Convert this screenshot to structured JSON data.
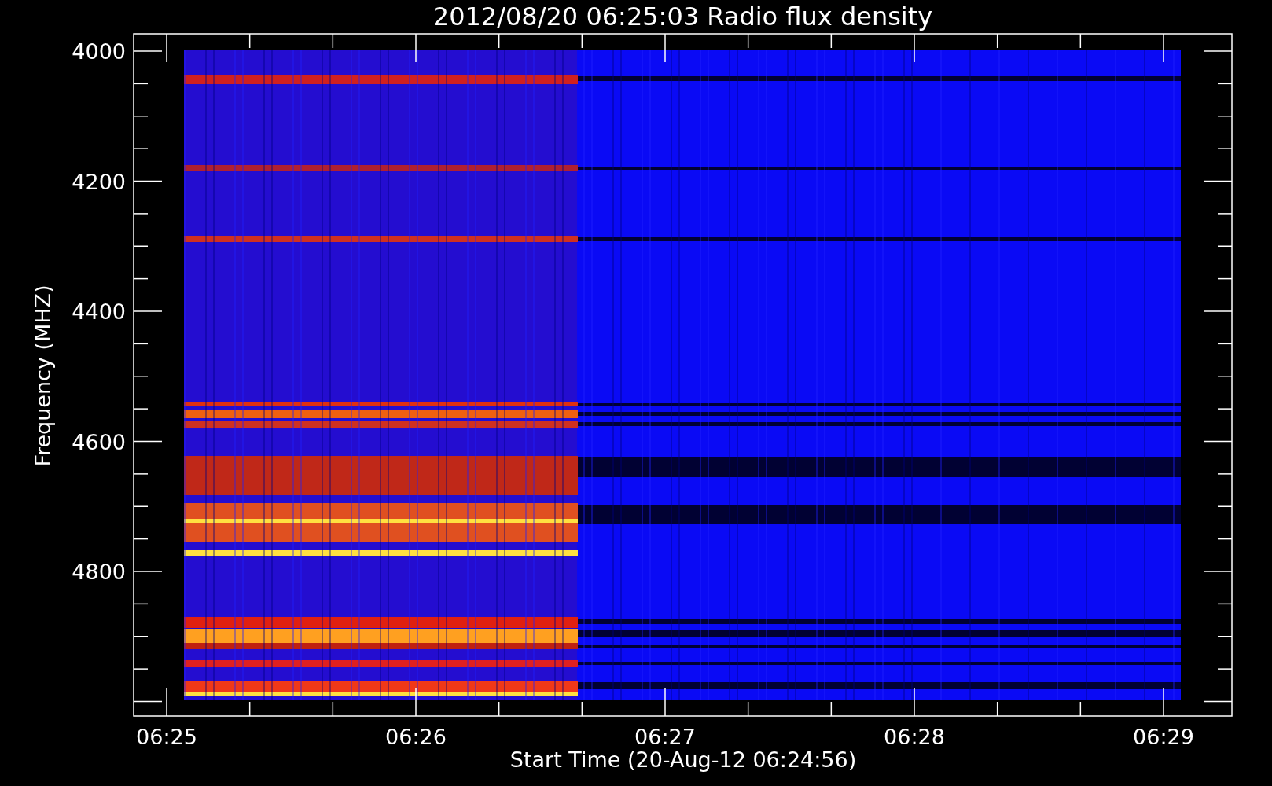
{
  "title": "2012/08/20 06:25:03 Radio flux density",
  "y_axis": {
    "label": "Frequency (MHZ)",
    "ticks": [
      "4000",
      "4200",
      "4400",
      "4600",
      "4800"
    ]
  },
  "x_axis": {
    "label": "Start Time (20-Aug-12 06:24:56)",
    "ticks": [
      "06:25",
      "06:26",
      "06:27",
      "06:28",
      "06:29"
    ]
  }
}
